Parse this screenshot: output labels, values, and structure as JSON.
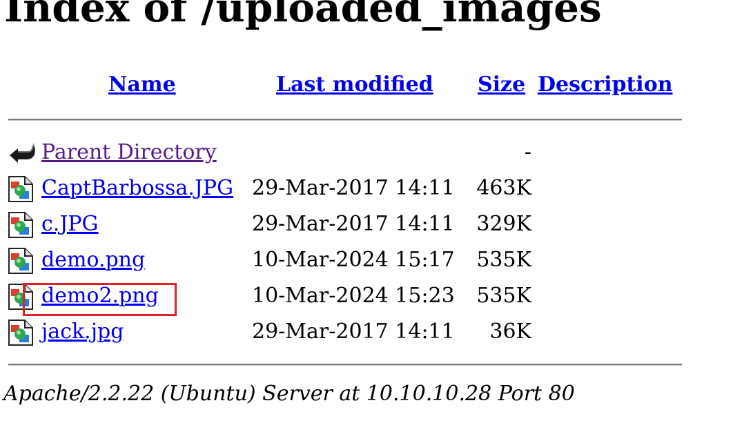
{
  "title": "Index of /uploaded_images",
  "columns": {
    "name": "Name",
    "last_modified": "Last modified",
    "size": "Size",
    "description": "Description"
  },
  "parent": {
    "label": "Parent Directory",
    "size": "-",
    "icon": "back-arrow-icon"
  },
  "rows": [
    {
      "name": "CaptBarbossa.JPG",
      "modified": "29-Mar-2017 14:11",
      "size": "463K",
      "icon": "image-file-icon"
    },
    {
      "name": "c.JPG",
      "modified": "29-Mar-2017 14:11",
      "size": "329K",
      "icon": "image-file-icon"
    },
    {
      "name": "demo.png",
      "modified": "10-Mar-2024 15:17",
      "size": "535K",
      "icon": "image-file-icon"
    },
    {
      "name": "demo2.png",
      "modified": "10-Mar-2024 15:23",
      "size": "535K",
      "icon": "image-file-icon",
      "highlighted": true
    },
    {
      "name": "jack.jpg",
      "modified": "29-Mar-2017 14:11",
      "size": "36K",
      "icon": "image-file-icon"
    }
  ],
  "footer": "Apache/2.2.22 (Ubuntu) Server at 10.10.10.28 Port 80",
  "colors": {
    "link": "#0000ee",
    "visited_link": "#551a8b",
    "highlight_box": "#e0202a"
  }
}
